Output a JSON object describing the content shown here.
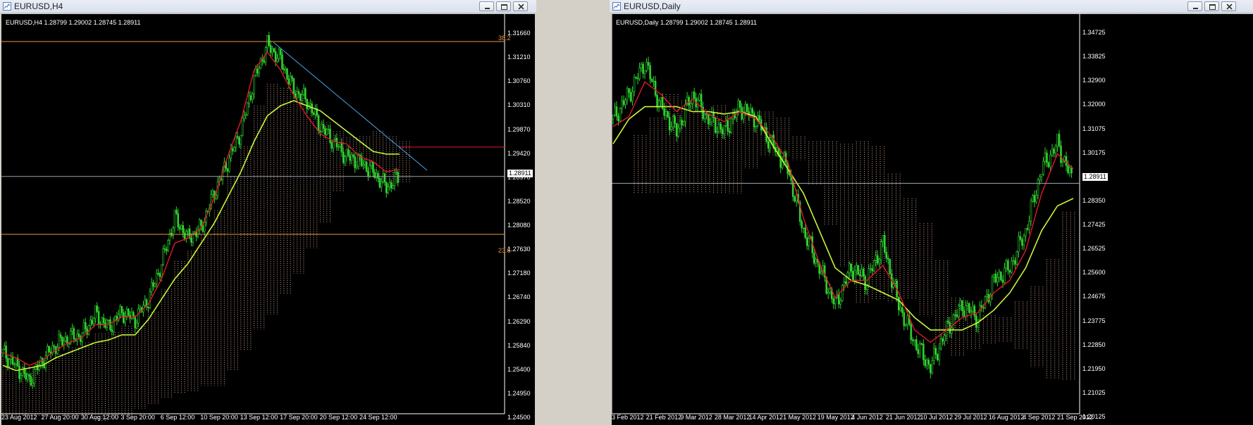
{
  "windows": [
    {
      "title": "EURUSD,H4",
      "info": "EURUSD,H4  1.28799 1.29002 1.28745 1.28911",
      "current_price": "1.28911",
      "price_axis": [
        "1.31660",
        "1.31210",
        "1.30760",
        "1.30310",
        "1.29870",
        "1.29420",
        "1.28970",
        "1.28520",
        "1.28080",
        "1.27630",
        "1.27180",
        "1.26740",
        "1.26290",
        "1.25840",
        "1.25400",
        "1.24950",
        "1.24500"
      ],
      "time_axis": [
        "23 Aug 2012",
        "27 Aug 20:00",
        "30 Aug 12:00",
        "3 Sep 20:00",
        "6 Sep 12:00",
        "10 Sep 20:00",
        "13 Sep 12:00",
        "17 Sep 20:00",
        "20 Sep 12:00",
        "24 Sep 12:00"
      ],
      "fib_levels": [
        "38.2",
        "23.6"
      ],
      "controls": [
        "minimize",
        "maximize",
        "close"
      ]
    },
    {
      "title": "EURUSD,Daily",
      "info": "EURUSD,Daily  1.28799 1.29002 1.28745 1.28911",
      "current_price": "1.28911",
      "price_axis": [
        "1.34725",
        "1.33825",
        "1.32900",
        "1.32000",
        "1.31075",
        "1.30175",
        "1.29250",
        "1.28350",
        "1.27425",
        "1.26525",
        "1.25600",
        "1.24675",
        "1.23775",
        "1.22850",
        "1.21950",
        "1.21025",
        "1.20125"
      ],
      "time_axis": [
        "3 Feb 2012",
        "21 Feb 2012",
        "9 Mar 2012",
        "28 Mar 2012",
        "14 Apr 2012",
        "1 May 2012",
        "19 May 2012",
        "4 Jun 2012",
        "21 Jun 2012",
        "10 Jul 2012",
        "29 Jul 2012",
        "16 Aug 2012",
        "4 Sep 2012",
        "21 Sep 2012"
      ],
      "controls": [
        "minimize",
        "maximize",
        "close"
      ]
    }
  ],
  "colors": {
    "background": "#000000",
    "candles": "#2fd12f",
    "tenkan": "#e0182c",
    "kijun": "#c8f53a",
    "cloud": "#e6b9a2",
    "fib": "#e79a45",
    "trendline": "#4aa3e8",
    "grid_text": "#ffffff"
  },
  "chart_data": [
    {
      "type": "line",
      "title": "EURUSD,H4",
      "ylim": [
        1.245,
        1.3185
      ],
      "series": [
        {
          "name": "close",
          "values": [
            1.2545,
            1.252,
            1.249,
            1.253,
            1.256,
            1.2575,
            1.258,
            1.262,
            1.2595,
            1.2625,
            1.261,
            1.265,
            1.272,
            1.281,
            1.277,
            1.279,
            1.286,
            1.292,
            1.298,
            1.308,
            1.315,
            1.312,
            1.306,
            1.304,
            1.299,
            1.296,
            1.293,
            1.292,
            1.29,
            1.287,
            1.2891
          ]
        },
        {
          "name": "tenkan",
          "values": [
            1.2545,
            1.2535,
            1.252,
            1.253,
            1.255,
            1.2565,
            1.2575,
            1.26,
            1.26,
            1.2615,
            1.2615,
            1.264,
            1.269,
            1.276,
            1.277,
            1.279,
            1.285,
            1.293,
            1.3,
            1.31,
            1.3135,
            1.31,
            1.305,
            1.301,
            1.2975,
            1.296,
            1.2955,
            1.293,
            1.292,
            1.29,
            1.2905
          ]
        },
        {
          "name": "kijun",
          "values": [
            1.252,
            1.251,
            1.2515,
            1.252,
            1.2535,
            1.2545,
            1.2555,
            1.2565,
            1.257,
            1.258,
            1.258,
            1.261,
            1.265,
            1.269,
            1.272,
            1.276,
            1.28,
            1.285,
            1.29,
            1.296,
            1.301,
            1.303,
            1.304,
            1.303,
            1.302,
            1.3,
            1.298,
            1.296,
            1.294,
            1.2935,
            1.2935
          ]
        }
      ]
    },
    {
      "type": "line",
      "title": "EURUSD,Daily",
      "ylim": [
        1.2002,
        1.3505
      ],
      "series": [
        {
          "name": "close",
          "values": [
            1.315,
            1.325,
            1.338,
            1.32,
            1.31,
            1.325,
            1.315,
            1.31,
            1.32,
            1.315,
            1.305,
            1.295,
            1.27,
            1.255,
            1.24,
            1.255,
            1.25,
            1.265,
            1.24,
            1.225,
            1.215,
            1.23,
            1.24,
            1.235,
            1.25,
            1.255,
            1.27,
            1.295,
            1.305,
            1.2891
          ]
        },
        {
          "name": "tenkan",
          "values": [
            1.312,
            1.316,
            1.33,
            1.325,
            1.318,
            1.323,
            1.317,
            1.314,
            1.318,
            1.315,
            1.308,
            1.298,
            1.275,
            1.257,
            1.243,
            1.25,
            1.25,
            1.256,
            1.245,
            1.23,
            1.225,
            1.23,
            1.235,
            1.237,
            1.245,
            1.25,
            1.262,
            1.285,
            1.301,
            1.295
          ]
        },
        {
          "name": "kijun",
          "values": [
            1.305,
            1.315,
            1.32,
            1.32,
            1.32,
            1.318,
            1.318,
            1.317,
            1.318,
            1.316,
            1.305,
            1.295,
            1.285,
            1.27,
            1.255,
            1.25,
            1.248,
            1.245,
            1.242,
            1.235,
            1.23,
            1.23,
            1.23,
            1.233,
            1.238,
            1.245,
            1.255,
            1.27,
            1.28,
            1.283
          ]
        }
      ]
    }
  ]
}
